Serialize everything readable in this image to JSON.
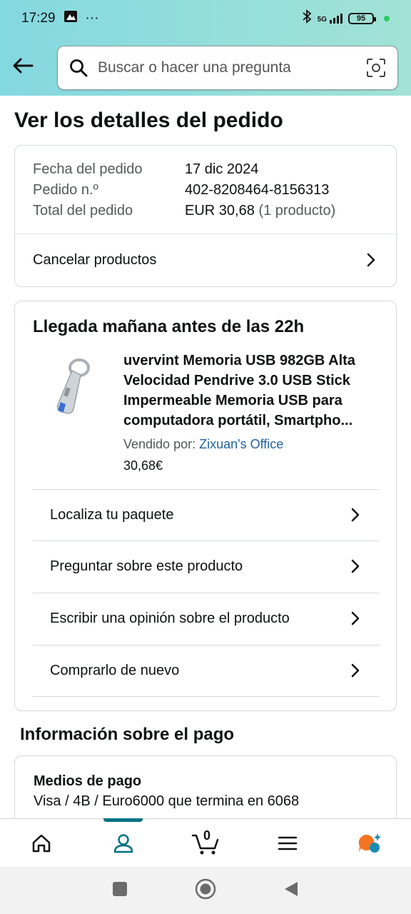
{
  "status_bar": {
    "time": "17:29",
    "dots": "···",
    "network": "5G",
    "battery": "95"
  },
  "search": {
    "placeholder": "Buscar o hacer una pregunta"
  },
  "page_title": "Ver los detalles del pedido",
  "order": {
    "date_label": "Fecha del pedido",
    "date_value": "17 dic 2024",
    "number_label": "Pedido n.º",
    "number_value": "402-8208464-8156313",
    "total_label": "Total del pedido",
    "total_value": "EUR 30,68",
    "total_count": "(1 producto)",
    "cancel_label": "Cancelar productos"
  },
  "shipment": {
    "arrival": "Llegada mañana antes de las 22h",
    "product_title": "uvervint Memoria USB 982GB Alta Velocidad Pendrive 3.0 USB Stick Impermeable Memoria USB para computadora portátil, Smartpho...",
    "sold_by_label": "Vendido por:",
    "seller": "Zixuan's Office",
    "price": "30,68€",
    "actions": [
      {
        "label": "Localiza tu paquete"
      },
      {
        "label": "Preguntar sobre este producto"
      },
      {
        "label": "Escribir una opinión sobre el producto"
      },
      {
        "label": "Comprarlo de nuevo"
      }
    ]
  },
  "payment": {
    "section_title": "Información sobre el pago",
    "method_heading": "Medios de pago",
    "method_value": "Visa / 4B / Euro6000  que termina en 6068"
  },
  "bottom_nav": {
    "items": [
      {
        "icon": "home-icon"
      },
      {
        "icon": "user-icon",
        "active": true
      },
      {
        "icon": "cart-icon",
        "count": "0"
      },
      {
        "icon": "menu-icon"
      },
      {
        "icon": "assistant-icon"
      }
    ]
  },
  "colors": {
    "header_gradient_start": "#84d8e0",
    "header_gradient_end": "#a2e3d6",
    "link": "#2162a1",
    "accent": "#007185"
  }
}
